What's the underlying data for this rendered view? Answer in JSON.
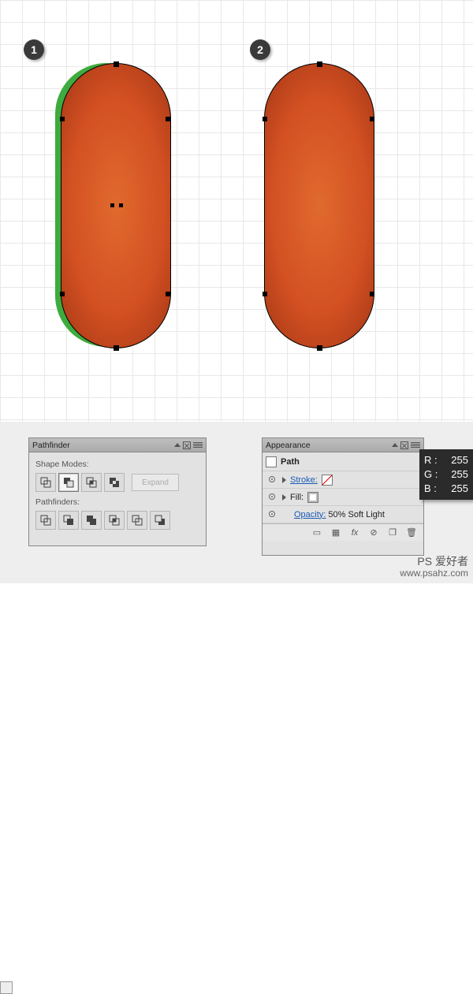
{
  "steps": {
    "one": "1",
    "two": "2"
  },
  "pathfinder": {
    "title": "Pathfinder",
    "shape_modes_label": "Shape Modes:",
    "pathfinders_label": "Pathfinders:",
    "expand_label": "Expand",
    "mode_icons": [
      "unite",
      "minus-front",
      "intersect",
      "exclude"
    ],
    "pf_icons": [
      "divide",
      "trim",
      "merge",
      "crop",
      "outline",
      "minus-back"
    ],
    "selected_mode_index": 1
  },
  "appearance": {
    "title": "Appearance",
    "object": "Path",
    "stroke_label": "Stroke:",
    "fill_label": "Fill:",
    "opacity_label": "Opacity:",
    "opacity_value": "50% Soft Light",
    "fx_label": "fx"
  },
  "rgb": {
    "r_label": "R :",
    "r": "255",
    "g_label": "G :",
    "g": "255",
    "b_label": "B :",
    "b": "255"
  },
  "watermark": {
    "line1": "PS 爱好者",
    "line2": "www.psahz.com"
  }
}
